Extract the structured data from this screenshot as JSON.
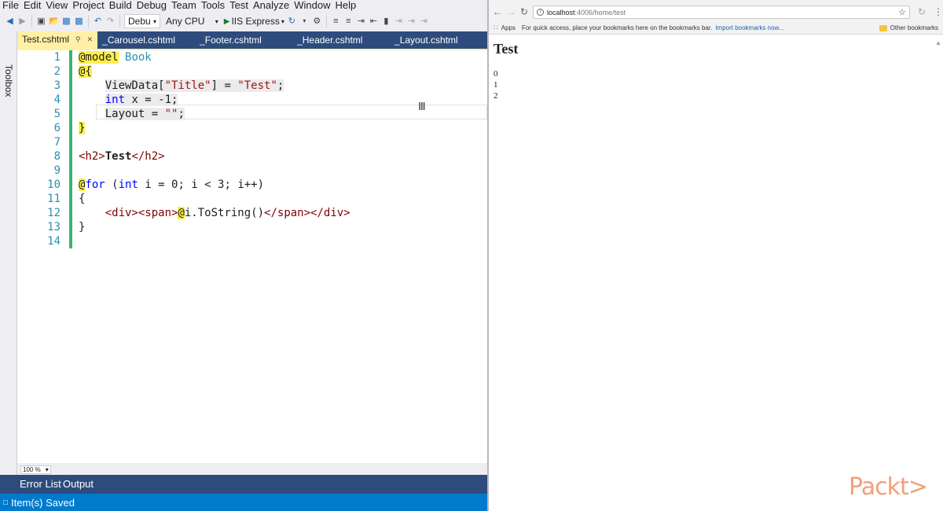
{
  "vs": {
    "menu": [
      "File",
      "Edit",
      "View",
      "Project",
      "Build",
      "Debug",
      "Team",
      "Tools",
      "Test",
      "Analyze",
      "Window",
      "Help"
    ],
    "toolbar": {
      "config": "Debu",
      "platform": "Any CPU",
      "run_target": "IIS Express"
    },
    "toolbox_label": "Toolbox",
    "tabs": [
      "Test.cshtml",
      "_Carousel.cshtml",
      "_Footer.cshtml",
      "_Header.cshtml",
      "_Layout.cshtml"
    ],
    "code_lines": [
      "1",
      "2",
      "3",
      "4",
      "5",
      "6",
      "7",
      "8",
      "9",
      "10",
      "11",
      "12",
      "13",
      "14"
    ],
    "code": {
      "l1_directive": "@model",
      "l1_type": "Book",
      "l2": "@{",
      "l3_a": "ViewData[",
      "l3_key": "\"Title\"",
      "l3_b": "] = ",
      "l3_val": "\"Test\"",
      "l3_c": ";",
      "l4_kw": "int",
      "l4_rest": " x = -1;",
      "l5_a": "Layout = ",
      "l5_val": "\"\"",
      "l5_c": ";",
      "l6": "}",
      "l8_open": "<h2>",
      "l8_text": "Test",
      "l8_close": "</h2>",
      "l10_at": "@",
      "l10_for": "for",
      "l10_a": " (",
      "l10_int": "int",
      "l10_b": " i = 0; i < 3; i++)",
      "l11": "{",
      "l12_open": "<div><span>",
      "l12_at": "@",
      "l12_expr": "i.ToString()",
      "l12_close": "</span></div>",
      "l13": "}"
    },
    "zoom": "100 %",
    "bottom_tabs": [
      "Error List",
      "Output"
    ],
    "status": "Item(s) Saved"
  },
  "browser": {
    "url_host": "localhost",
    "url_path": ":4006/home/test",
    "bookmarks": {
      "apps": "Apps",
      "hint": "For quick access, place your bookmarks here on the bookmarks bar.",
      "import": "Import bookmarks now...",
      "other": "Other bookmarks"
    },
    "page": {
      "title": "Test",
      "items": [
        "0",
        "1",
        "2"
      ]
    }
  },
  "watermark": "Packt>",
  "colors": {
    "vs_tab_bar": "#2d4c7d",
    "vs_active_tab": "#fff0a6",
    "vs_status": "#007acc",
    "razor_highlight": "#fff04a",
    "line_numbers": "#2b91af",
    "change_bar": "#3cb371"
  }
}
